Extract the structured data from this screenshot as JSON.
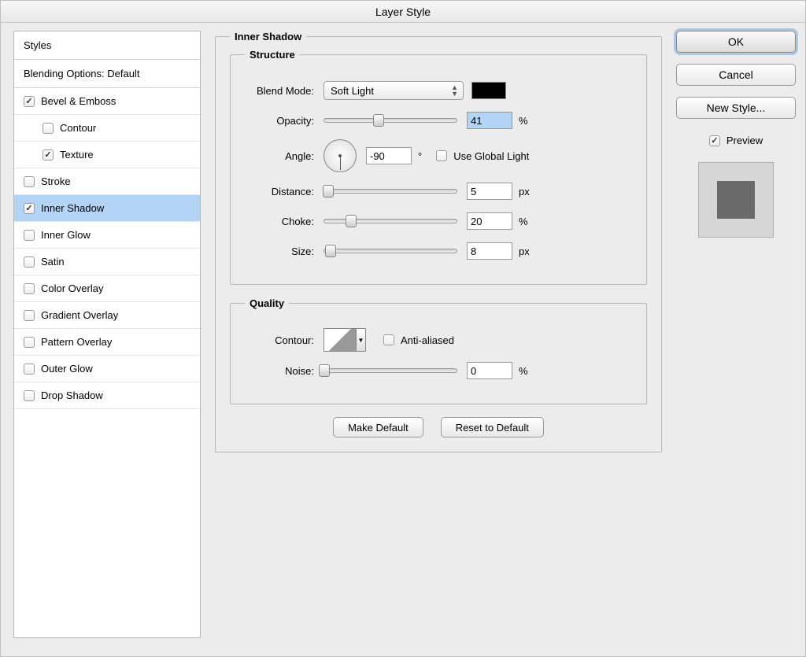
{
  "title": "Layer Style",
  "stylesHeader": "Styles",
  "blendingOptions": "Blending Options: Default",
  "styleItems": [
    {
      "label": "Bevel & Emboss",
      "checked": true,
      "indent": false
    },
    {
      "label": "Contour",
      "checked": false,
      "indent": true
    },
    {
      "label": "Texture",
      "checked": true,
      "indent": true
    },
    {
      "label": "Stroke",
      "checked": false,
      "indent": false
    },
    {
      "label": "Inner Shadow",
      "checked": true,
      "indent": false,
      "selected": true
    },
    {
      "label": "Inner Glow",
      "checked": false,
      "indent": false
    },
    {
      "label": "Satin",
      "checked": false,
      "indent": false
    },
    {
      "label": "Color Overlay",
      "checked": false,
      "indent": false
    },
    {
      "label": "Gradient Overlay",
      "checked": false,
      "indent": false
    },
    {
      "label": "Pattern Overlay",
      "checked": false,
      "indent": false
    },
    {
      "label": "Outer Glow",
      "checked": false,
      "indent": false
    },
    {
      "label": "Drop Shadow",
      "checked": false,
      "indent": false
    }
  ],
  "panel": {
    "title": "Inner Shadow",
    "structure": {
      "legend": "Structure",
      "blendModeLabel": "Blend Mode:",
      "blendModeValue": "Soft Light",
      "opacityLabel": "Opacity:",
      "opacityValue": "41",
      "opacityUnit": "%",
      "angleLabel": "Angle:",
      "angleValue": "-90",
      "angleUnit": "°",
      "useGlobalLight": "Use Global Light",
      "distanceLabel": "Distance:",
      "distanceValue": "5",
      "distanceUnit": "px",
      "chokeLabel": "Choke:",
      "chokeValue": "20",
      "chokeUnit": "%",
      "sizeLabel": "Size:",
      "sizeValue": "8",
      "sizeUnit": "px"
    },
    "quality": {
      "legend": "Quality",
      "contourLabel": "Contour:",
      "antiAliased": "Anti-aliased",
      "noiseLabel": "Noise:",
      "noiseValue": "0",
      "noiseUnit": "%"
    },
    "makeDefault": "Make Default",
    "resetDefault": "Reset to Default"
  },
  "buttons": {
    "ok": "OK",
    "cancel": "Cancel",
    "newStyle": "New Style...",
    "preview": "Preview"
  }
}
